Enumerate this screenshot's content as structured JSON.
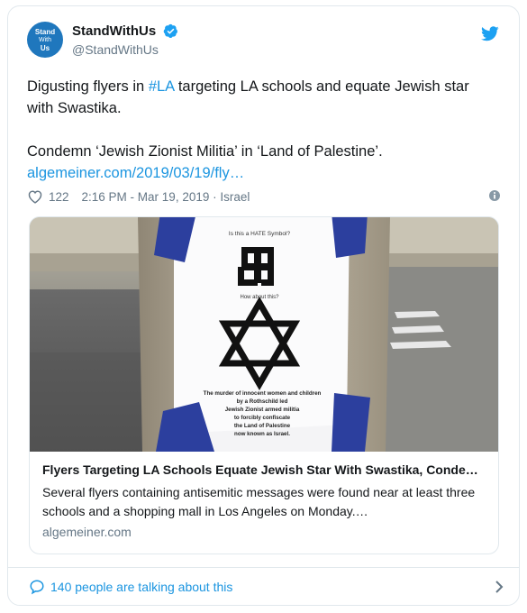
{
  "user": {
    "avatar_text": [
      "Stand",
      "With",
      "Us"
    ],
    "name": "StandWithUs",
    "handle": "@StandWithUs"
  },
  "tweet": {
    "line1_before": "Digusting flyers in ",
    "hashtag": "#LA",
    "line1_after": " targeting LA schools and equate Jewish star with Swastika.",
    "line2": "Condemn ‘Jewish Zionist Militia’ in ‘Land of Palestine’.",
    "link": "algemeiner.com/2019/03/19/fly…"
  },
  "meta": {
    "likes": "122",
    "timestamp": "2:16 PM - Mar 19, 2019",
    "location": "Israel"
  },
  "link_card": {
    "title": "Flyers Targeting LA Schools Equate Jewish Star With Swastika, Condem…",
    "description": "Several flyers containing antisemitic messages were found near at least three schools and a shopping mall in Los Angeles on Monday.…",
    "domain": "algemeiner.com",
    "flyer": {
      "question1": "Is this a HATE Symbol?",
      "question2": "How about this?",
      "text": [
        "The murder of innocent women and children",
        "by a Rothschild led",
        "Jewish Zionist armed militia",
        "to forcibly confiscate",
        "the Land of Palestine",
        "now known as Israel."
      ]
    }
  },
  "footer": {
    "talking": "140 people are talking about this"
  },
  "colors": {
    "accent": "#1b95e0",
    "verified": "#1da1f2",
    "muted": "#657786",
    "border": "#e1e8ed",
    "brand_avatar": "#1f77bd"
  },
  "icons": [
    "verified-badge-icon",
    "twitter-bird-icon",
    "heart-icon",
    "info-icon",
    "speech-bubble-icon",
    "chevron-right-icon"
  ]
}
